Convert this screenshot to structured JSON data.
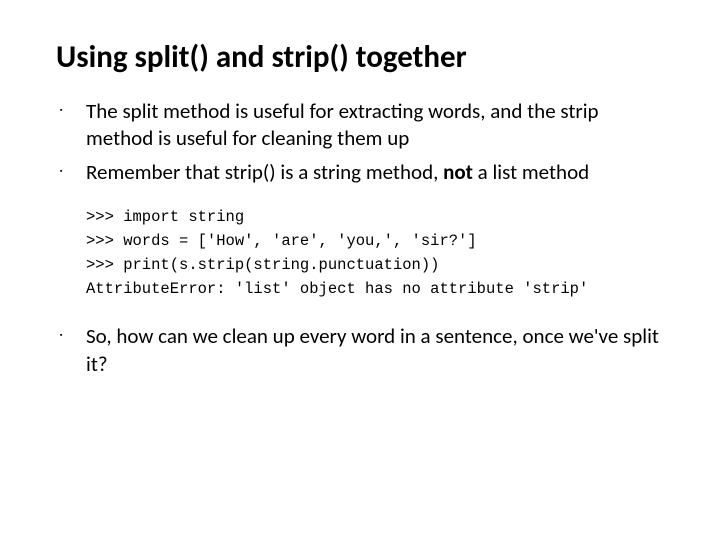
{
  "title": "Using split() and strip() together",
  "bullets": {
    "b1": "The split method is useful for extracting words, and the strip method is useful for cleaning them up",
    "b2a": "Remember that strip() is a string method, ",
    "b2bold": "not",
    "b2c": " a list method",
    "b3": "So, how can we clean up every word in a sentence, once we've split it?"
  },
  "code": {
    "l1": ">>> import string",
    "l2": ">>> words = ['How', 'are', 'you,', 'sir?']",
    "l3": ">>> print(s.strip(string.punctuation))",
    "l4": "AttributeError: 'list' object has no attribute 'strip'"
  }
}
